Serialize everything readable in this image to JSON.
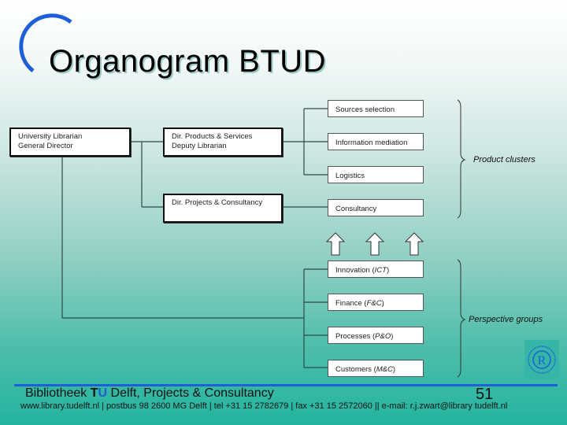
{
  "slide": {
    "title": "Organogram BTUD",
    "accent_color": "#1d5fd6"
  },
  "org": {
    "root": {
      "line1": "University Librarian",
      "line2": "General Director"
    },
    "directors": [
      {
        "line1": "Dir. Products & Services",
        "line2": "Deputy Librarian"
      },
      {
        "line1": "Dir. Projects & Consultancy",
        "line2": ""
      }
    ],
    "product_clusters": {
      "label": "Product clusters",
      "items": [
        "Sources selection",
        "Information mediation",
        "Logistics",
        "Consultancy"
      ]
    },
    "perspective_groups": {
      "label": "Perspective groups",
      "items": [
        {
          "name": "Innovation (",
          "abbr": "ICT",
          "close": ")"
        },
        {
          "name": "Finance (",
          "abbr": "F&C",
          "close": ")"
        },
        {
          "name": "Processes (",
          "abbr": "P&O",
          "close": ")"
        },
        {
          "name": "Customers (",
          "abbr": "M&C",
          "close": ")"
        }
      ]
    },
    "arrows": [
      "up-arrow",
      "up-arrow",
      "up-arrow"
    ]
  },
  "footer": {
    "title_prefix": "Bibliotheek ",
    "title_t": "T",
    "title_u": "U",
    "title_suffix": " Delft, Projects & Consultancy",
    "page_number": "51",
    "contact": "www.library.tudelft.nl | postbus 98 2600 MG Delft | tel +31 15 2782679 | fax +31 15 2572060 || e-mail: r.j.zwart@library tudelft.nl",
    "logo_letter": "R"
  }
}
